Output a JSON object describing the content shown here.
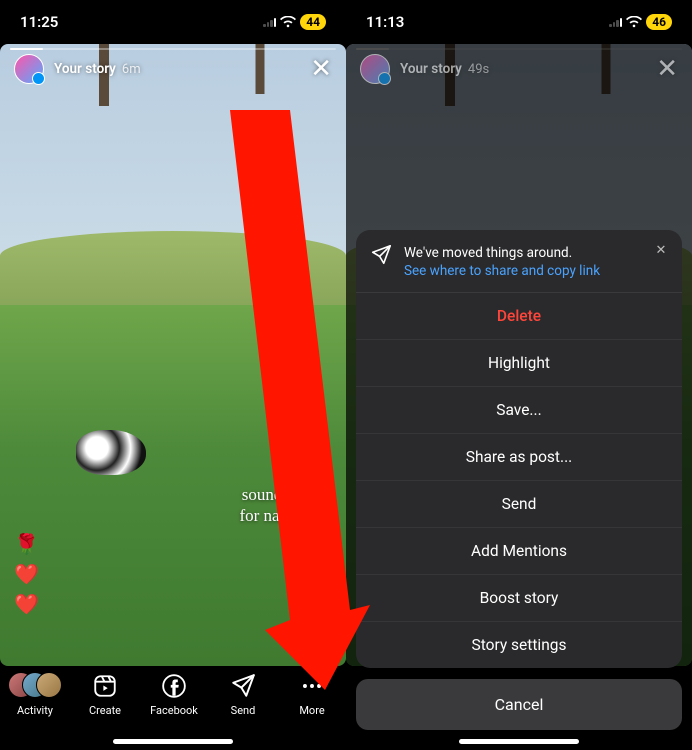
{
  "left": {
    "status": {
      "time": "11:25",
      "battery": "44"
    },
    "story": {
      "title": "Your story",
      "time_ago": "6m",
      "caption": "sound on\nfor nature",
      "reactions": [
        "🌹",
        "❤️",
        "❤️"
      ]
    },
    "bottom_bar": {
      "activity": "Activity",
      "create": "Create",
      "facebook": "Facebook",
      "send": "Send",
      "more": "More"
    }
  },
  "right": {
    "status": {
      "time": "11:13",
      "battery": "46"
    },
    "story": {
      "title": "Your story",
      "time_ago": "49s"
    },
    "sheet": {
      "notice": "We've moved things around.",
      "notice_link": "See where to share and copy link",
      "items": {
        "delete": "Delete",
        "highlight": "Highlight",
        "save": "Save...",
        "share_post": "Share as post...",
        "send": "Send",
        "add_mentions": "Add Mentions",
        "boost": "Boost story",
        "settings": "Story settings"
      },
      "cancel": "Cancel"
    }
  }
}
